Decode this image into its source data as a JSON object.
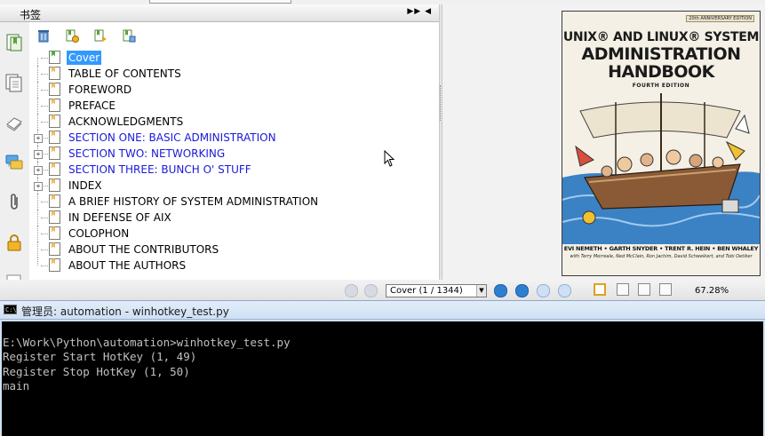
{
  "reader": {
    "bookmarks_title": "书签",
    "bookmarks_header_buttons": "▶▶ ◀",
    "bookmarks": [
      {
        "label": "Cover",
        "expandable": false,
        "selected": true,
        "link": false
      },
      {
        "label": "TABLE OF CONTENTS",
        "expandable": false,
        "selected": false,
        "link": false
      },
      {
        "label": "FOREWORD",
        "expandable": false,
        "selected": false,
        "link": false
      },
      {
        "label": "PREFACE",
        "expandable": false,
        "selected": false,
        "link": false
      },
      {
        "label": "ACKNOWLEDGMENTS",
        "expandable": false,
        "selected": false,
        "link": false
      },
      {
        "label": "SECTION ONE: BASIC ADMINISTRATION",
        "expandable": true,
        "selected": false,
        "link": true
      },
      {
        "label": "SECTION TWO: NETWORKING",
        "expandable": true,
        "selected": false,
        "link": true
      },
      {
        "label": "SECTION THREE: BUNCH O' STUFF",
        "expandable": true,
        "selected": false,
        "link": true
      },
      {
        "label": "INDEX",
        "expandable": true,
        "selected": false,
        "link": false
      },
      {
        "label": "A BRIEF HISTORY OF SYSTEM ADMINISTRATION",
        "expandable": false,
        "selected": false,
        "link": false
      },
      {
        "label": "IN DEFENSE OF AIX",
        "expandable": false,
        "selected": false,
        "link": false
      },
      {
        "label": "COLOPHON",
        "expandable": false,
        "selected": false,
        "link": false
      },
      {
        "label": "ABOUT THE CONTRIBUTORS",
        "expandable": false,
        "selected": false,
        "link": false
      },
      {
        "label": "ABOUT THE AUTHORS",
        "expandable": false,
        "selected": false,
        "link": false
      }
    ],
    "cover": {
      "badge": "20th ANNIVERSARY EDITION",
      "title_line1": "UNIX® AND LINUX® SYSTEM",
      "title_line2": "ADMINISTRATION",
      "title_line3": "HANDBOOK",
      "edition": "FOURTH EDITION",
      "authors": "EVI NEMETH • GARTH SNYDER • TRENT R. HEIN • BEN WHALEY",
      "contributors": "with Terry Morreale, Ned McClain, Ron Jachim, David Schweikert, and Tobi Oetiker"
    },
    "status": {
      "page_value": "Cover (1 / 1344)",
      "zoom": "67.28%"
    },
    "colors": {
      "selected_bg": "#3399ff",
      "link_text": "#1a1ad8",
      "bookmark_icon": "#e8c15a"
    }
  },
  "console": {
    "title": "管理员: automation - winhotkey_test.py",
    "lines": [
      "E:\\Work\\Python\\automation>winhotkey_test.py",
      "Register Start HotKey (1, 49)",
      "Register Stop HotKey (1, 50)",
      "main"
    ]
  }
}
